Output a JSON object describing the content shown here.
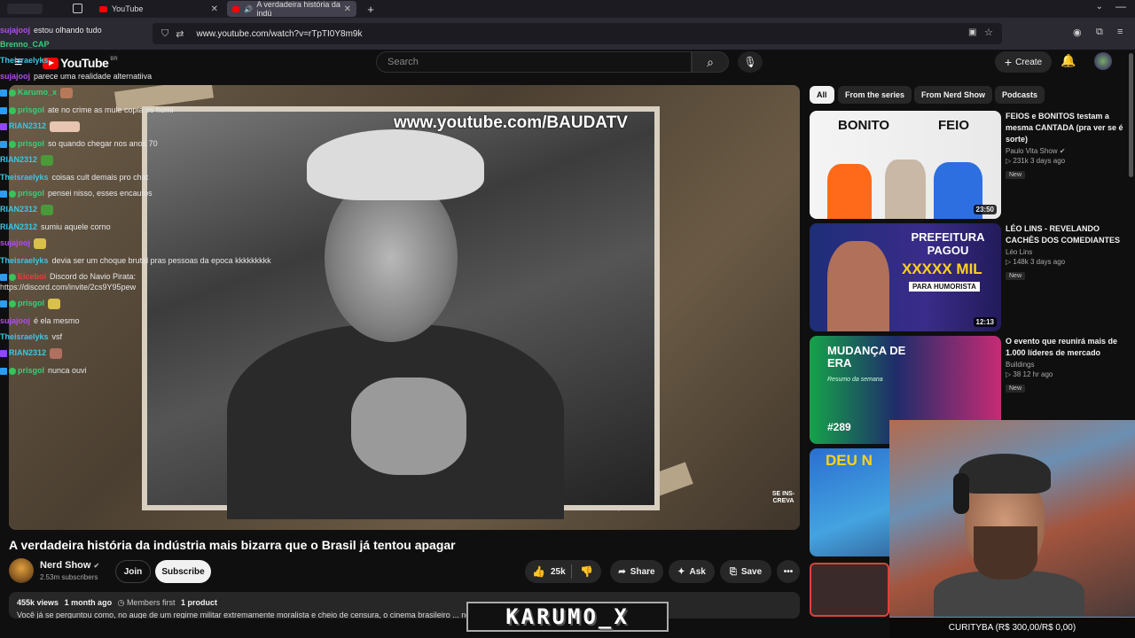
{
  "browser": {
    "tabs": [
      {
        "title": "YouTube"
      },
      {
        "title": "A verdadeira história da indú"
      }
    ],
    "url": "www.youtube.com/watch?v=rTpTI0Y8m9k"
  },
  "header": {
    "logo": "YouTube",
    "region": "BR",
    "search_placeholder": "Search",
    "create_label": "Create"
  },
  "player": {
    "watermark": "www.youtube.com/BAUDATV",
    "corner_mark": "SE INS- CREVA"
  },
  "chat": [
    {
      "user": "sujajooj",
      "color": "#b04cf0",
      "text": "estou olhando tudo"
    },
    {
      "user": "Brenno_CAP",
      "color": "#33d17a",
      "text": ""
    },
    {
      "user": "Theisraelyks",
      "color": "#3ac6e8",
      "text": ""
    },
    {
      "user": "sujajooj",
      "color": "#b04cf0",
      "text": "parece uma realidade alternatiiva"
    },
    {
      "user": "Karumo_x",
      "color": "#33d17a",
      "text": ""
    },
    {
      "user": "prisgol",
      "color": "#33d17a",
      "text": "ate no crime as mule copia os homi"
    },
    {
      "user": "RIAN2312",
      "color": "#3ac6e8",
      "text": ""
    },
    {
      "user": "prisgol",
      "color": "#33d17a",
      "text": "so quando chegar nos anos 70"
    },
    {
      "user": "RIAN2312",
      "color": "#3ac6e8",
      "text": ""
    },
    {
      "user": "Theisraelyks",
      "color": "#3ac6e8",
      "text": "coisas cult demais pro chat"
    },
    {
      "user": "prisgol",
      "color": "#33d17a",
      "text": "pensei nisso, esses encautos"
    },
    {
      "user": "RIAN2312",
      "color": "#3ac6e8",
      "text": ""
    },
    {
      "user": "RIAN2312",
      "color": "#3ac6e8",
      "text": "sumiu aquele corno"
    },
    {
      "user": "sujajooj",
      "color": "#b04cf0",
      "text": ""
    },
    {
      "user": "Theisraelyks",
      "color": "#3ac6e8",
      "text": "devia ser um choque brutal pras pessoas da epoca kkkkkkkkk"
    },
    {
      "user": "Eiceboi",
      "color": "#e0413a",
      "text": "Discord do Navio Pirata: https://discord.com/invite/2cs9Y95pew"
    },
    {
      "user": "prisgol",
      "color": "#33d17a",
      "text": ""
    },
    {
      "user": "sujajooj",
      "color": "#b04cf0",
      "text": "é ela mesmo"
    },
    {
      "user": "Theisraelyks",
      "color": "#3ac6e8",
      "text": "vsf"
    },
    {
      "user": "RIAN2312",
      "color": "#3ac6e8",
      "text": ""
    },
    {
      "user": "prisgol",
      "color": "#33d17a",
      "text": "nunca ouvi"
    }
  ],
  "video": {
    "title": "A verdadeira história da indústria mais bizarra que o Brasil já tentou apagar",
    "channel": "Nerd Show",
    "subscribers": "2.53m subscribers",
    "join_label": "Join",
    "subscribe_label": "Subscribe",
    "likes": "25k",
    "share_label": "Share",
    "ask_label": "Ask",
    "save_label": "Save",
    "views": "455k views",
    "age": "1 month ago",
    "members": "Members first",
    "products": "1 product",
    "description": "Você já se perguntou como, no auge de um regime militar extremamente moralista e cheio de censura, o cinema brasileiro ... nédia erótica? Parece um erro na"
  },
  "filters": [
    "All",
    "From the series",
    "From Nerd Show",
    "Podcasts"
  ],
  "recommended": [
    {
      "title": "FEIOS e BONITOS testam a mesma CANTADA (pra ver se é sorte)",
      "channel": "Paulo Vita Show",
      "verified": true,
      "views": "231k",
      "age": "3 days ago",
      "badge": "New",
      "duration": "23:50",
      "thumb_text_1": "BONITO",
      "thumb_text_2": "FEIO"
    },
    {
      "title": "LÉO LINS - REVELANDO CACHÊS DOS COMEDIANTES",
      "channel": "Léo Lins",
      "verified": false,
      "views": "148k",
      "age": "3 days ago",
      "badge": "New",
      "duration": "12:13",
      "thumb_text_1": "PREFEITURA PAGOU",
      "thumb_text_2": "XXXXX MIL",
      "thumb_text_3": "PARA HUMORISTA"
    },
    {
      "title": "O evento que reunirá mais de 1.000 líderes de mercado",
      "channel": "Buildings",
      "verified": false,
      "views": "38",
      "age": "12 hr ago",
      "badge": "New",
      "duration": "",
      "thumb_text_1": "MUDANÇA DE ERA",
      "thumb_text_2": "Resumo da semana",
      "thumb_text_3": "#289"
    },
    {
      "title": "",
      "channel": "",
      "verified": false,
      "views": "",
      "age": "",
      "badge": "",
      "duration": "",
      "thumb_text_1": "DEU N"
    }
  ],
  "overlay": {
    "nameplate": "KARUMO_X",
    "goal": "CURITYBA (R$ 300,00/R$ 0,00)"
  },
  "colors": {
    "youtube_red": "#ff0000",
    "background": "#0f0f0f",
    "chip": "#272727"
  }
}
